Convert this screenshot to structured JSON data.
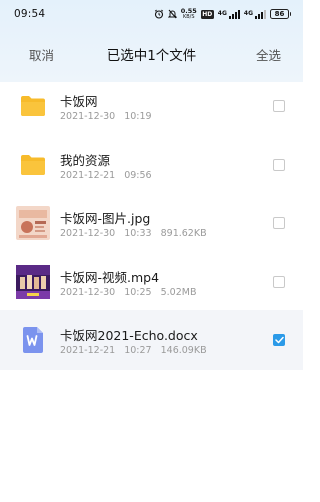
{
  "status_bar": {
    "time": "09:54",
    "speed_value": "0.55",
    "speed_unit": "KB/S",
    "hd_label": "HD",
    "sim1_label": "4G",
    "sim2_label": "4G",
    "battery": "86"
  },
  "header": {
    "cancel_label": "取消",
    "title": "已选中1个文件",
    "select_all_label": "全选"
  },
  "files": [
    {
      "name": "卡饭网",
      "date": "2021-12-30",
      "time": "10:19",
      "size": "",
      "type": "folder",
      "checked": false
    },
    {
      "name": "我的资源",
      "date": "2021-12-21",
      "time": "09:56",
      "size": "",
      "type": "folder",
      "checked": false
    },
    {
      "name": "卡饭网-图片.jpg",
      "date": "2021-12-30",
      "time": "10:33",
      "size": "891.62KB",
      "type": "image",
      "checked": false
    },
    {
      "name": "卡饭网-视频.mp4",
      "date": "2021-12-30",
      "time": "10:25",
      "size": "5.02MB",
      "type": "video",
      "checked": false
    },
    {
      "name": "卡饭网2021-Echo.docx",
      "date": "2021-12-21",
      "time": "10:27",
      "size": "146.09KB",
      "type": "docx",
      "checked": true
    }
  ],
  "colors": {
    "folder": "#f7bb2b",
    "accent": "#2b9ae8",
    "docx_icon": "#7b93ee"
  }
}
